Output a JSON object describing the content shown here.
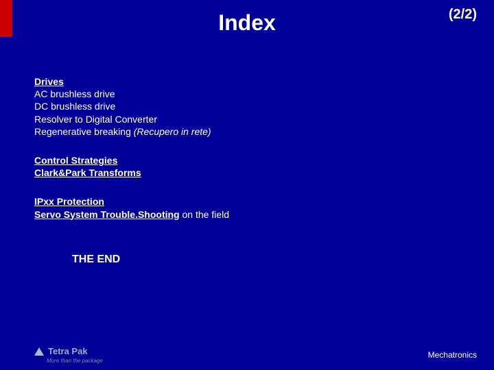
{
  "title": "Index",
  "page_indicator": "(2/2)",
  "sections": {
    "drives": {
      "heading": "Drives",
      "items": [
        "AC  brushless drive",
        "DC  brushless drive",
        "Resolver to Digital Converter"
      ],
      "regen_prefix": "Regenerative breaking ",
      "regen_italic": "(Recupero in rete)"
    },
    "control": {
      "line1": "Control Strategies",
      "line2": "Clark&Park Transforms"
    },
    "ip_servo": {
      "line1": "IPxx Protection",
      "line2_link": "Servo System Trouble.Shooting",
      "line2_suffix": " on the field"
    }
  },
  "end_text": "THE END",
  "footer": {
    "logo_text": "Tetra Pak",
    "tagline": "More than the package",
    "right": "Mechatronics"
  }
}
